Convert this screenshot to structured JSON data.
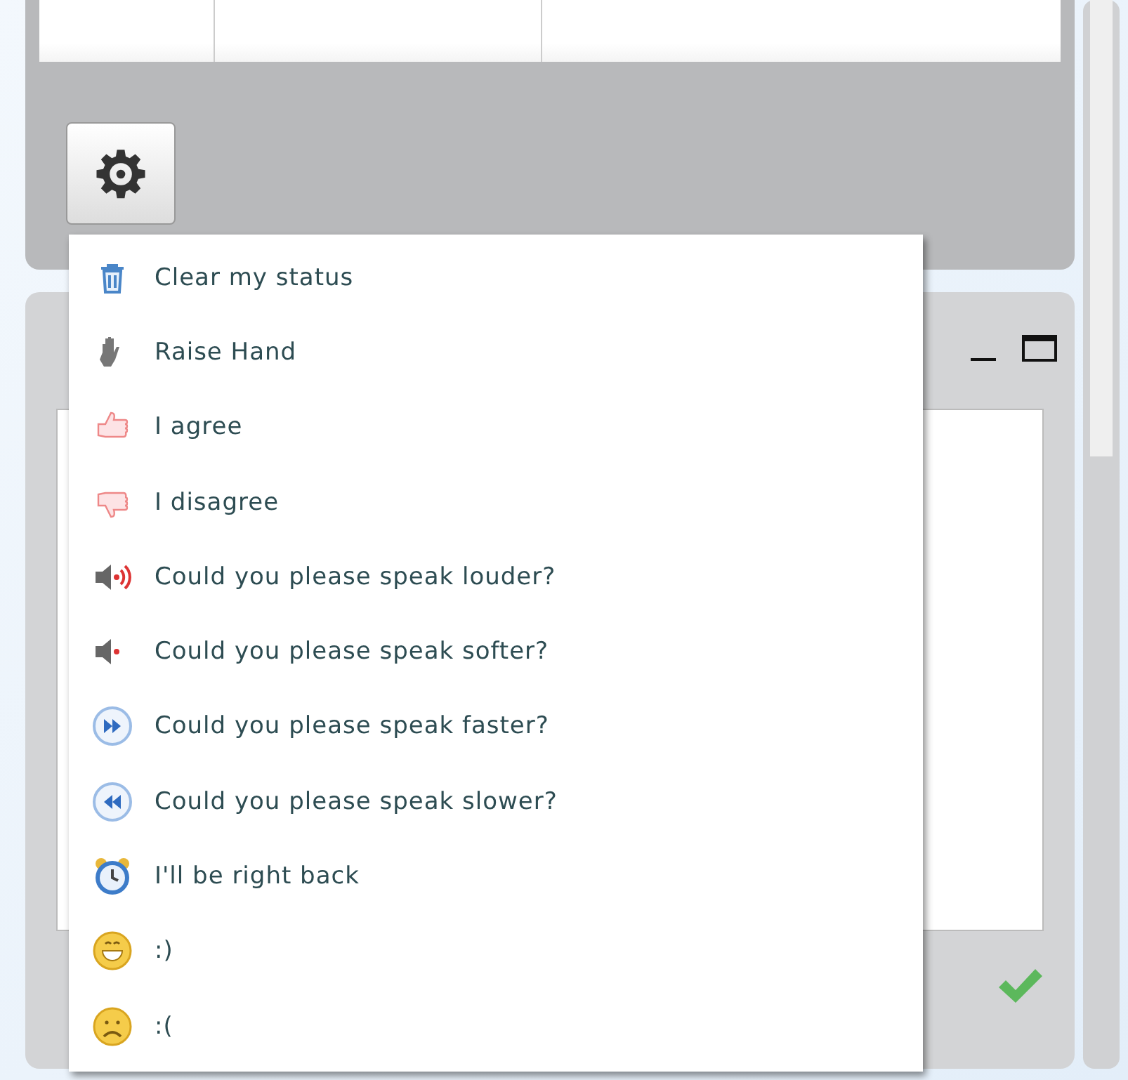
{
  "status_menu": {
    "items": [
      {
        "kind": "trash",
        "label": "Clear my status"
      },
      {
        "kind": "hand",
        "label": "Raise Hand"
      },
      {
        "kind": "thumbs-up",
        "label": "I agree"
      },
      {
        "kind": "thumbs-down",
        "label": "I disagree"
      },
      {
        "kind": "speaker-loud",
        "label": "Could you please speak louder?"
      },
      {
        "kind": "speaker-soft",
        "label": "Could you please speak softer?"
      },
      {
        "kind": "fast-forward",
        "label": "Could you please speak faster?"
      },
      {
        "kind": "rewind",
        "label": "Could you please speak slower?"
      },
      {
        "kind": "alarm-clock",
        "label": "I'll be right back"
      },
      {
        "kind": "smile",
        "label": ":)"
      },
      {
        "kind": "frown",
        "label": ":("
      }
    ]
  }
}
